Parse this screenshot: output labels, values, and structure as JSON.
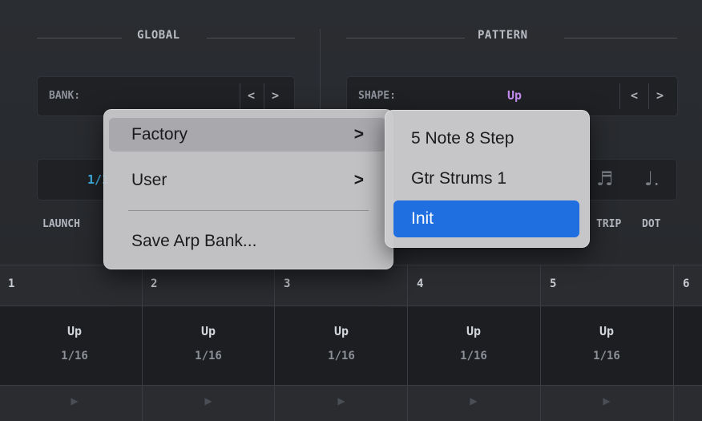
{
  "global": {
    "title": "GLOBAL",
    "bank_label": "BANK:",
    "bank_value": "",
    "prev_arrow": "<",
    "next_arrow": ">",
    "rate_value": "1/1",
    "launch_label": "LAUNCH"
  },
  "pattern": {
    "title": "PATTERN",
    "shape_label": "SHAPE:",
    "shape_value": "Up",
    "shape_value_color": "#c58cf0",
    "prev_arrow": "<",
    "next_arrow": ">",
    "triplet_label": "TRIP",
    "dotted_label": "DOT",
    "triplet_icon": "♬",
    "dotted_icon": "♩."
  },
  "context_menu": {
    "items": [
      {
        "label": "Factory",
        "chevron": ">",
        "highlighted": true
      },
      {
        "label": "User",
        "chevron": ">"
      },
      {
        "label": "Save Arp Bank..."
      }
    ]
  },
  "submenu": {
    "items": [
      {
        "label": "5 Note 8 Step"
      },
      {
        "label": "Gtr Strums 1"
      },
      {
        "label": "Init",
        "selected": true
      }
    ],
    "selected_color": "#1f6fe0"
  },
  "steps": {
    "headers": [
      "1",
      "2",
      "3",
      "4",
      "5",
      "6"
    ],
    "cells": [
      {
        "shape": "Up",
        "rate": "1/16"
      },
      {
        "shape": "Up",
        "rate": "1/16"
      },
      {
        "shape": "Up",
        "rate": "1/16"
      },
      {
        "shape": "Up",
        "rate": "1/16"
      },
      {
        "shape": "Up",
        "rate": "1/16"
      }
    ],
    "play_icon": "▶"
  },
  "colors": {
    "accent_blue": "#40b4e6",
    "shape_purple": "#c58cf0"
  }
}
